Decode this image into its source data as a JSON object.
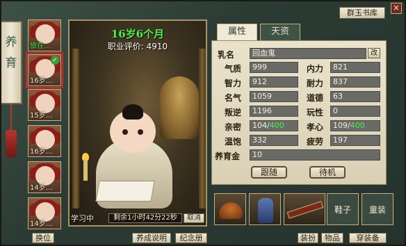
{
  "window": {
    "close_label": "×"
  },
  "side_scroll": {
    "text": "养育"
  },
  "children": [
    {
      "age": "旅在…",
      "age_highlight": true,
      "selected": false
    },
    {
      "age": "16岁…",
      "age_highlight": false,
      "selected": true
    },
    {
      "age": "15岁…",
      "age_highlight": false,
      "selected": false
    },
    {
      "age": "16岁…",
      "age_highlight": false,
      "selected": false
    },
    {
      "age": "14岁…",
      "age_highlight": false,
      "selected": false
    },
    {
      "age": "14岁…",
      "age_highlight": false,
      "selected": false
    }
  ],
  "buttons": {
    "swap": "换位",
    "guide": "养成说明",
    "memorial": "纪念册",
    "dressup": "装扮",
    "items": "物品",
    "equip": "穿装备",
    "library": "群玉书库",
    "follow": "跟随",
    "wait": "待机",
    "rename": "改"
  },
  "portrait": {
    "age_title": "16岁6个月",
    "rating_label": "职业评价:",
    "rating_value": "4910",
    "study_label": "学习中",
    "study_timer": "剩余1小时42分22秒",
    "cancel_label": "取消"
  },
  "tabs": [
    {
      "label": "属性",
      "active": true
    },
    {
      "label": "天资",
      "active": false
    }
  ],
  "stats": {
    "name_label": "乳名",
    "name_value": "回血鬼",
    "left": [
      {
        "label": "气质",
        "value": "999"
      },
      {
        "label": "智力",
        "value": "912"
      },
      {
        "label": "名气",
        "value": "1059"
      },
      {
        "label": "叛逆",
        "value": "1196"
      },
      {
        "label": "亲密",
        "value": "104/",
        "max": "400"
      },
      {
        "label": "温饱",
        "value": "332"
      }
    ],
    "right": [
      {
        "label": "内力",
        "value": "821"
      },
      {
        "label": "耐力",
        "value": "837"
      },
      {
        "label": "道德",
        "value": "63"
      },
      {
        "label": "玩性",
        "value": "0"
      },
      {
        "label": "孝心",
        "value": "109/",
        "max": "400"
      },
      {
        "label": "疲劳",
        "value": "197"
      }
    ],
    "total_label": "养育金",
    "total_value": "10"
  },
  "equipment": [
    {
      "slot": "hat",
      "label": ""
    },
    {
      "slot": "robe",
      "label": ""
    },
    {
      "slot": "weapon",
      "label": ""
    },
    {
      "slot": "shoes",
      "label": "鞋子"
    },
    {
      "slot": "outfit",
      "label": "童装"
    }
  ]
}
